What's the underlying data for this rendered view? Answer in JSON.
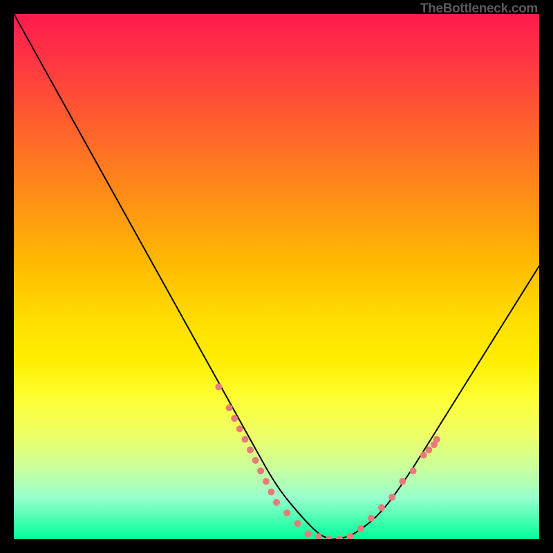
{
  "watermark": "TheBottleneck.com",
  "chart_data": {
    "type": "line",
    "title": "",
    "xlabel": "",
    "ylabel": "",
    "xlim": [
      0,
      100
    ],
    "ylim": [
      0,
      100
    ],
    "grid": false,
    "legend": false,
    "series": [
      {
        "name": "bottleneck-curve",
        "x": [
          0,
          5,
          10,
          15,
          20,
          25,
          30,
          35,
          40,
          45,
          50,
          55,
          58,
          60,
          62,
          65,
          70,
          75,
          80,
          85,
          90,
          95,
          100
        ],
        "y": [
          100,
          91,
          82,
          73,
          64,
          55,
          46,
          37,
          28,
          19,
          10,
          4,
          1,
          0,
          0,
          1,
          5,
          12,
          20,
          28,
          36,
          44,
          52
        ],
        "color": "#000000"
      }
    ],
    "markers": [
      {
        "name": "left-slope-markers",
        "x": [
          39,
          41,
          42,
          43,
          44,
          45,
          46,
          47,
          48,
          49,
          50,
          52,
          54
        ],
        "y": [
          29,
          25,
          23,
          21,
          19,
          17,
          15,
          13,
          11,
          9,
          7,
          5,
          3
        ],
        "color": "#e87a7a",
        "radius_px": 5
      },
      {
        "name": "trough-markers",
        "x": [
          56,
          58,
          60,
          62,
          64
        ],
        "y": [
          1,
          0.5,
          0,
          0,
          0.5
        ],
        "color": "#e87a7a",
        "radius_px": 5
      },
      {
        "name": "right-slope-markers",
        "x": [
          66,
          68,
          70,
          72,
          74,
          76,
          78,
          79,
          80,
          80.5
        ],
        "y": [
          2,
          4,
          6,
          8,
          11,
          13,
          16,
          17,
          18,
          19
        ],
        "color": "#e87a7a",
        "radius_px": 5
      }
    ],
    "background_gradient": {
      "top": "#ff1a4d",
      "bottom": "#00ff99"
    }
  }
}
